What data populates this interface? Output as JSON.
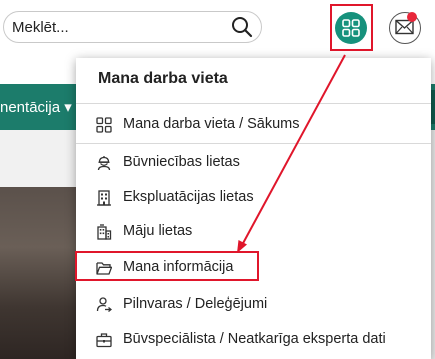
{
  "search": {
    "placeholder": "Meklēt..."
  },
  "nav": {
    "item_label": "nentācija ▾"
  },
  "menu": {
    "title": "Mana darba vieta",
    "items": [
      {
        "label": "Mana darba vieta / Sākums",
        "icon": "grid-icon"
      },
      {
        "label": "Būvniecības lietas",
        "icon": "worker-icon"
      },
      {
        "label": "Ekspluatācijas lietas",
        "icon": "building-icon"
      },
      {
        "label": "Māju lietas",
        "icon": "apartment-icon"
      },
      {
        "label": "Mana informācija",
        "icon": "folder-icon"
      },
      {
        "label": "Pilnvaras / Deleģējumi",
        "icon": "user-delegate-icon"
      },
      {
        "label": "Būvspeciālista / Neatkarīga eksperta dati",
        "icon": "briefcase-icon"
      }
    ]
  },
  "colors": {
    "accent": "#16917c",
    "annotation": "#e0162b",
    "nav_bg": "#1c7c6b"
  }
}
